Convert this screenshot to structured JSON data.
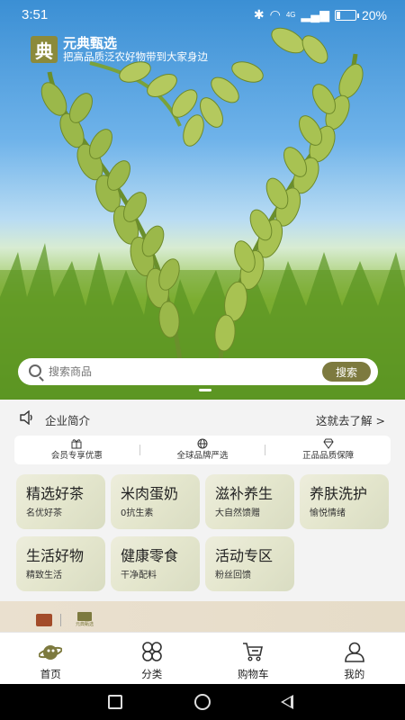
{
  "status_bar": {
    "time": "3:51",
    "signal": "4G",
    "battery": "20%",
    "battery_level": 0.2
  },
  "brand": {
    "logo_char": "典",
    "name": "元典甄选",
    "slogan": "把高品质泛农好物带到大家身边"
  },
  "search": {
    "placeholder": "搜索商品",
    "button_label": "搜索"
  },
  "intro": {
    "label": "企业简介",
    "link": "这就去了解 >"
  },
  "promo": [
    {
      "icon": "gift-icon",
      "label": "会员专享优惠"
    },
    {
      "icon": "globe-icon",
      "label": "全球品牌严选"
    },
    {
      "icon": "diamond-icon",
      "label": "正品品质保障"
    }
  ],
  "categories": [
    {
      "title": "精选好茶",
      "subtitle": "名优好茶"
    },
    {
      "title": "米肉蛋奶",
      "subtitle": "0抗生素"
    },
    {
      "title": "滋补养生",
      "subtitle": "大自然馈赠"
    },
    {
      "title": "养肤洗护",
      "subtitle": "愉悦情绪"
    },
    {
      "title": "生活好物",
      "subtitle": "精致生活"
    },
    {
      "title": "健康零食",
      "subtitle": "干净配料"
    },
    {
      "title": "活动专区",
      "subtitle": "粉丝回馈"
    }
  ],
  "banner": {
    "logo_text": "元典甄选"
  },
  "tabs": [
    {
      "label": "首页",
      "icon": "planet-icon",
      "active": true
    },
    {
      "label": "分类",
      "icon": "grid-icon",
      "active": false
    },
    {
      "label": "购物车",
      "icon": "cart-icon",
      "active": false
    },
    {
      "label": "我的",
      "icon": "user-icon",
      "active": false
    }
  ],
  "colors": {
    "accent": "#7d7a3f",
    "card_bg": "#e4e6cd",
    "sky": "#3b8fd4"
  }
}
